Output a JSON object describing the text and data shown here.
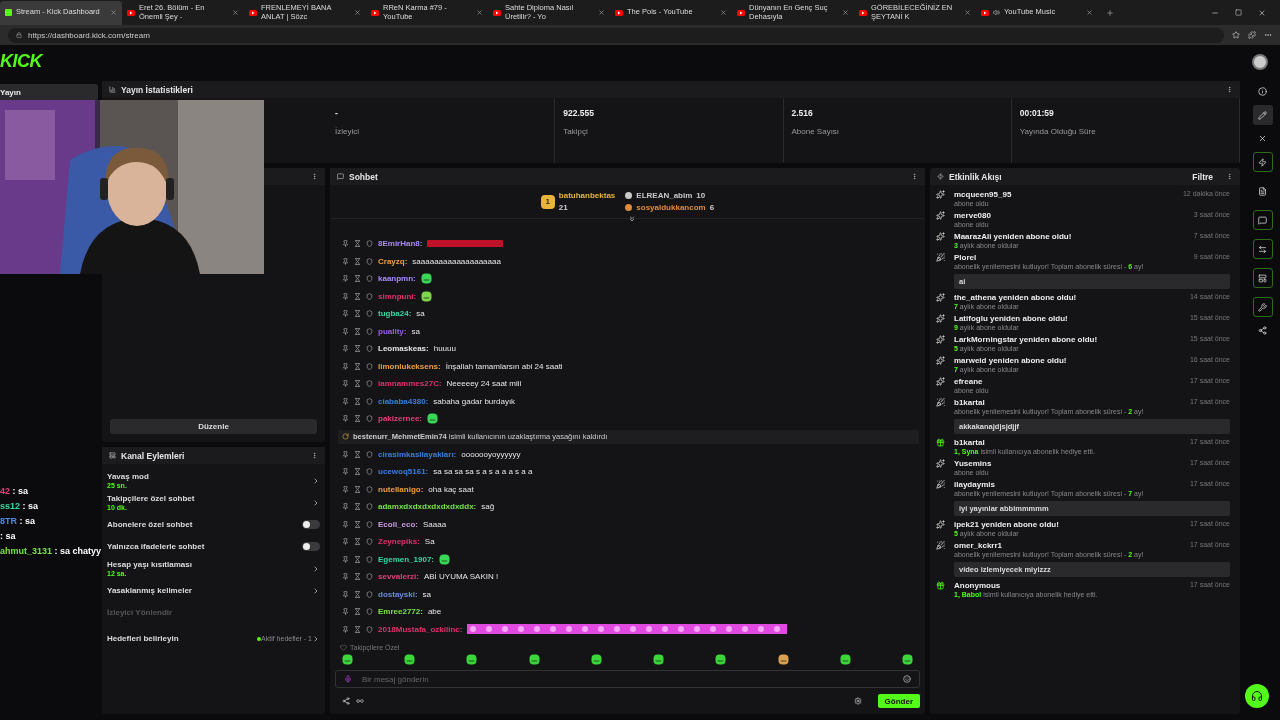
{
  "browser": {
    "tabs": [
      {
        "title": "Stream - Kick Dashboard",
        "kind": "kick",
        "selected": true,
        "audio": false
      },
      {
        "title": "Eret 26. Bölüm - En Önemli Şey -",
        "kind": "youtube",
        "selected": false,
        "audio": false
      },
      {
        "title": "FRENLEMEYİ BANA ANLAT | Sözc",
        "kind": "youtube",
        "selected": false,
        "audio": false
      },
      {
        "title": "RReN Karma #79 - YouTube",
        "kind": "youtube",
        "selected": false,
        "audio": false
      },
      {
        "title": "Sahte Diploma Nasıl Üretilir? - Yo",
        "kind": "youtube",
        "selected": false,
        "audio": false
      },
      {
        "title": "The Pois - YouTube",
        "kind": "youtube",
        "selected": false,
        "audio": false
      },
      {
        "title": "Dünyanın En Genç Suç Dehasıyla",
        "kind": "youtube",
        "selected": false,
        "audio": false
      },
      {
        "title": "GÖREBİLECEĞİNİZ EN ŞEYTANİ K",
        "kind": "youtube",
        "selected": false,
        "audio": false
      },
      {
        "title": "YouTube Music",
        "kind": "youtube",
        "selected": false,
        "audio": true
      }
    ],
    "url": "https://dashboard.kick.com/stream"
  },
  "header": {
    "logo": "KICK"
  },
  "sidebar": {
    "items": [
      {
        "label": "Yayın",
        "selected": true
      }
    ],
    "overlay_chat": [
      {
        "name": "42",
        "text": " : sa",
        "color": "#e0407a"
      },
      {
        "name": "ss12",
        "text": " : sa",
        "color": "#3ad6a0"
      },
      {
        "name": "8TR",
        "text": " : sa",
        "color": "#4a8be0"
      },
      {
        "text": ": sa"
      },
      {
        "name": "ahmut_3131",
        "text": " : sa chatyy",
        "color": "#7be04a"
      }
    ]
  },
  "stats": {
    "title": "Yayın İstatistikleri",
    "items": [
      {
        "value": "-",
        "label": "İzleyici"
      },
      {
        "value": "922.555",
        "label": "Takipçi"
      },
      {
        "value": "2.516",
        "label": "Abone Sayısı"
      },
      {
        "value": "00:01:59",
        "label": "Yayında Olduğu Süre"
      }
    ]
  },
  "preview": {
    "button": "Düzenle"
  },
  "channel_actions": {
    "title": "Kanal Eylemleri",
    "items": [
      {
        "kind": "link",
        "label": "Yavaş mod",
        "value": "25 sn.",
        "disabled": false
      },
      {
        "kind": "link",
        "label": "Takipçilere özel sohbet",
        "value": "10 dk.",
        "disabled": false
      },
      {
        "kind": "toggle",
        "label": "Abonelere özel sohbet",
        "on": false
      },
      {
        "kind": "toggle",
        "label": "Yalnızca ifadelerle sohbet",
        "on": false
      },
      {
        "kind": "link",
        "label": "Hesap yaşı kısıtlaması",
        "value": "12 sa.",
        "disabled": false
      },
      {
        "kind": "link",
        "label": "Yasaklanmış kelimeler",
        "disabled": false
      },
      {
        "kind": "link",
        "label": "İzleyici Yönlendir",
        "disabled": true
      },
      {
        "kind": "goal",
        "label": "Hedefleri belirleyin",
        "status": "Aktif hedefler - 1"
      }
    ]
  },
  "chat": {
    "title": "Sohbet",
    "leaders": [
      {
        "name": "batuhanbektas",
        "count": "21",
        "rank": "1",
        "color": "#e8b53a"
      },
      {
        "name": "ELREAN_abim",
        "count": "10",
        "color": "#c9c9c9"
      },
      {
        "name": "sosyaldukkancom",
        "count": "6",
        "color": "#e08a3a"
      }
    ],
    "messages": [
      {
        "kind": "redacted",
        "user": "8EmirHan8:",
        "color": "#a78bfa"
      },
      {
        "kind": "text",
        "user": "Crayzq:",
        "text": " saaaaaaaaaaaaaaaaaaa",
        "color": "#f0a03c"
      },
      {
        "kind": "emote",
        "user": "kaanpmn:",
        "color": "#a78bfa"
      },
      {
        "kind": "emote",
        "user": "simnpuni:",
        "color": "#e0306a"
      },
      {
        "kind": "text",
        "user": "tugba24:",
        "text": " sa",
        "color": "#3ad6a0"
      },
      {
        "kind": "text",
        "user": "puality:",
        "text": " sa",
        "color": "#9b5cf0"
      },
      {
        "kind": "text",
        "user": "Leomaskeas:",
        "text": " huuuu",
        "color": "#e6e6e6"
      },
      {
        "kind": "text",
        "user": "limonlukeksens:",
        "text": " İnşallah tamamlarsın abi 24 saati",
        "color": "#f0a03c"
      },
      {
        "kind": "text",
        "user": "iamnammes27C:",
        "text": " Neeeeey 24 saat miii",
        "color": "#e0306a"
      },
      {
        "kind": "text",
        "user": "ciababa4380:",
        "text": " sabaha gadar burdayık",
        "color": "#3a7ee0"
      },
      {
        "kind": "emote",
        "user": "pakizernee:",
        "color": "#e0407a"
      },
      {
        "kind": "system",
        "user": "bestenurr_MehmetEmin74",
        "text": " isimli kullanıcının uzaklaştırma yasağını kaldırdı"
      },
      {
        "kind": "text",
        "user": "cirasimkasllayakları:",
        "text": " ooooooyoyyyyyy",
        "color": "#3a7ee0"
      },
      {
        "kind": "text",
        "user": "ucewoq5161:",
        "text": " sa sa sa sa s a s a a a s a a",
        "color": "#3a7ee0"
      },
      {
        "kind": "text",
        "user": "nutellanigo:",
        "text": " oha kaç saat",
        "color": "#f0a03c"
      },
      {
        "kind": "text",
        "user": "adamxdxdxdxdxdxdxddx:",
        "text": " sağ",
        "color": "#7be04a"
      },
      {
        "kind": "text",
        "user": "Ecoli_eco:",
        "text": " Saaaa",
        "color": "#c89be0"
      },
      {
        "kind": "text",
        "user": "Zeynepiks:",
        "text": " Sa",
        "color": "#e0306a"
      },
      {
        "kind": "emote",
        "user": "Egemen_1907:",
        "color": "#3ad6a0"
      },
      {
        "kind": "text",
        "user": "sevvalerzi:",
        "text": " ABİ UYUMA SAKIN !",
        "color": "#e0407a"
      },
      {
        "kind": "text",
        "user": "dostayski:",
        "text": " sa",
        "color": "#6a8be0"
      },
      {
        "kind": "text",
        "user": "Emree2772:",
        "text": " abe",
        "color": "#7be04a"
      },
      {
        "kind": "emote_strip",
        "user": "2018Mustafa_ozkilinc:",
        "color": "#e0306a"
      }
    ],
    "emote_label": "Takipçilere Özel",
    "placeholder": "Bir mesaj gönderin",
    "send": "Gönder"
  },
  "feed": {
    "title": "Etkinlik Akışı",
    "filter": "Filtre",
    "items": [
      {
        "kind": "sub",
        "title": "mcqueen95_95",
        "time": "12 dakika önce",
        "parts": [
          {
            "text": "abone oldu",
            "highlight": false
          }
        ]
      },
      {
        "kind": "sub",
        "title": "merve080",
        "time": "3 saat önce",
        "parts": [
          {
            "text": "abone oldu",
            "highlight": false
          }
        ]
      },
      {
        "kind": "sub",
        "title": "MaarazAli yeniden abone oldu!",
        "time": "7 saat önce",
        "parts": [
          {
            "text": "3",
            "highlight": true
          },
          {
            "text": " aylık abone oldular",
            "highlight": false
          }
        ]
      },
      {
        "kind": "renew",
        "title": "Plorel",
        "time": "9 saat önce",
        "parts": [
          {
            "text": "abonelik yenilemesini kutluyor! Toplam abonelik süresi - ",
            "highlight": false
          },
          {
            "text": "6",
            "highlight": true
          },
          {
            "text": " ay!",
            "highlight": false
          }
        ],
        "message": "ai"
      },
      {
        "kind": "sub",
        "title": "the_athena yeniden abone oldu!",
        "time": "14 saat önce",
        "parts": [
          {
            "text": "7",
            "highlight": true
          },
          {
            "text": " aylık abone oldular",
            "highlight": false
          }
        ]
      },
      {
        "kind": "sub",
        "title": "Latifoglu yeniden abone oldu!",
        "time": "15 saat önce",
        "parts": [
          {
            "text": "9",
            "highlight": true
          },
          {
            "text": " aylık abone oldular",
            "highlight": false
          }
        ]
      },
      {
        "kind": "sub",
        "title": "LarkMorningstar yeniden abone oldu!",
        "time": "15 saat önce",
        "parts": [
          {
            "text": "5",
            "highlight": true
          },
          {
            "text": " aylık abone oldular",
            "highlight": false
          }
        ]
      },
      {
        "kind": "sub",
        "title": "marweid yeniden abone oldu!",
        "time": "16 saat önce",
        "parts": [
          {
            "text": "7",
            "highlight": true
          },
          {
            "text": " aylık abone oldular",
            "highlight": false
          }
        ]
      },
      {
        "kind": "sub",
        "title": "efreane",
        "time": "17 saat önce",
        "parts": [
          {
            "text": "abone oldu",
            "highlight": false
          }
        ]
      },
      {
        "kind": "renew",
        "title": "b1kartal",
        "time": "17 saat önce",
        "parts": [
          {
            "text": "abonelik yenilemesini kutluyor! Toplam abonelik süresi - ",
            "highlight": false
          },
          {
            "text": "2",
            "highlight": true
          },
          {
            "text": " ay!",
            "highlight": false
          }
        ],
        "message": "akkakanajdjsjdjjf"
      },
      {
        "kind": "gift",
        "title": "b1kartal",
        "time": "17 saat önce",
        "parts": [
          {
            "text": "1, Syna",
            "highlight": true
          },
          {
            "text": " isimli kullanıcıya abonelik hediye etti.",
            "highlight": false
          }
        ]
      },
      {
        "kind": "sub",
        "title": "Yusemins",
        "time": "17 saat önce",
        "parts": [
          {
            "text": "abone oldu",
            "highlight": false
          }
        ]
      },
      {
        "kind": "renew",
        "title": "ilaydaymis",
        "time": "17 saat önce",
        "parts": [
          {
            "text": "abonelik yenilemesini kutluyor! Toplam abonelik süresi - ",
            "highlight": false
          },
          {
            "text": "7",
            "highlight": true
          },
          {
            "text": " ay!",
            "highlight": false
          }
        ],
        "message": "iyi yayınlar abbimmmmm"
      },
      {
        "kind": "sub",
        "title": "ipek21 yeniden abone oldu!",
        "time": "17 saat önce",
        "parts": [
          {
            "text": "5",
            "highlight": true
          },
          {
            "text": " aylık abone oldular",
            "highlight": false
          }
        ]
      },
      {
        "kind": "renew",
        "title": "omer_kckrr1",
        "time": "17 saat önce",
        "parts": [
          {
            "text": "abonelik yenilemesini kutluyor! Toplam abonelik süresi - ",
            "highlight": false
          },
          {
            "text": "2",
            "highlight": true
          },
          {
            "text": " ay!",
            "highlight": false
          }
        ],
        "message": "video izlemiyecek miyizzz"
      },
      {
        "kind": "gift",
        "title": "Anonymous",
        "time": "17 saat önce",
        "parts": [
          {
            "text": "1, Babol",
            "highlight": true
          },
          {
            "text": " isimli kullanıcıya abonelik hediye etti.",
            "highlight": false
          }
        ]
      }
    ]
  }
}
